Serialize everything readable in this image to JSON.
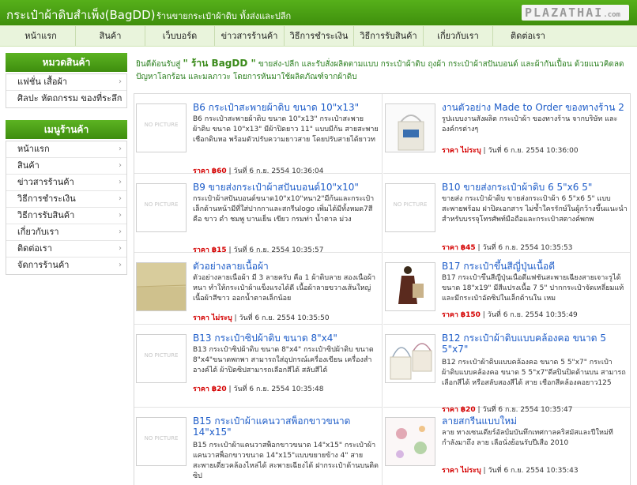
{
  "header": {
    "title": "กระเป๋าผ้าดิบสำเพ็ง(BagDD)",
    "slogan": "ร้านขายกระเป๋าผ้าดิบ ทั้งส่งและปลีก",
    "logo_main": "PLAZATHAI",
    "logo_suffix": ".com"
  },
  "topnav": [
    "หน้าแรก",
    "สินค้า",
    "เว็บบอร์ด",
    "ข่าวสารร้านค้า",
    "วิธีการชำระเงิน",
    "วิธีการรับสินค้า",
    "เกี่ยวกับเรา",
    "ติดต่อเรา"
  ],
  "categories": {
    "title": "หมวดสินค้า",
    "items": [
      "แฟชั่น เสื้อผ้า",
      "ศิลปะ หัตถกรรม ของที่ระลึก"
    ]
  },
  "shop_menu": {
    "title": "เมนูร้านค้า",
    "items": [
      "หน้าแรก",
      "สินค้า",
      "ข่าวสารร้านค้า",
      "วิธีการชำระเงิน",
      "วิธีการรับสินค้า",
      "เกี่ยวกับเรา",
      "ติดต่อเรา",
      "จัดการร้านค้า"
    ]
  },
  "welcome": {
    "prefix": "ยินดีต้อนรับสู่",
    "shop_name": "\" ร้าน BagDD \"",
    "text": "ขายส่ง-ปลีก และรับสั่งผลิตตามแบบ กระเป๋าผ้าดิบ ถุงผ้า กระเป๋าผ้าสปันบอนด์ และผ้ากันเปื้อน ด้วยแนวคิดลดปัญหาโลกร้อน และมลภาวะ โดยการหันมาใช้ผลิตภัณฑ์จากผ้าดิบ"
  },
  "labels": {
    "price": "ราคา",
    "date": "วันที่",
    "no_picture": "NO PICTURE"
  },
  "products": [
    {
      "title": "B6 กระเป๋าสะพายผ้าดิบ ขนาด 10\"x13\"",
      "desc": "B6 กระเป๋าสะพายผ้าดิบ ขนาด 10\"x13\" กระเป๋าสะพายผ้าดิบ ขนาด 10\"x13\" มีผ้าปิดยาว 11\" แบบมีก้น สายสะพายเชือกดิบหอ พร้อมตัวปรับความยาวสาย โดยปรับสายได้ยาวท",
      "price": "฿60",
      "date": "6 ก.ย. 2554 10:36:04",
      "image": "none"
    },
    {
      "title": "งานตัวอย่าง Made to Order ของทางร้าน 2",
      "desc": "รูปแบบงานสั่งผลิต กระเป๋าผ้า ของทางร้าน จากบริษัท และองค์กรต่างๆ",
      "price": "ไม่ระบุ",
      "date": "6 ก.ย. 2554 10:36:00",
      "image": "tote"
    },
    {
      "title": "B9 ขายส่งกระเป๋าผ้าสปันบอนด์10\"x10\"",
      "desc": "กระเป๋าผ้าสปันบอนด์ขนาด10\"x10\"หนา2\"มีก้นและกระเป๋าเล็กด้านหน้ามีที่ใส่ปากกาและสกรีนlogo เพิ่มได้มีทั้งหมด7สีคือ ขาว ดำ ชมพู บานเย็น เขียว กรมท่า น้ำตาล ม่วง",
      "price": "฿15",
      "date": "6 ก.ย. 2554 10:35:57",
      "image": "none"
    },
    {
      "title": "B10 ขายส่งกระเป๋าผ้าดิบ 6 5\"x6 5\"",
      "desc": "ขายส่ง กระเป๋าผ้าดิบ ขายส่งกระเป๋าผ้า 6 5\"x6 5\" แบบสะพายพร้อม ฝาปิดเอกสาร ไม่ซ้ำใครรักษ์ในผู้กว้างขึ้นแนะนำสำหรับบรรจุโทรศัพท์มือถือและกระเป๋าสตางค์พกพ",
      "price": "฿45",
      "date": "6 ก.ย. 2554 10:35:53",
      "image": "none"
    },
    {
      "title": "ตัวอย่างลายเนื้อผ้า",
      "desc": "ตัวอย่างลายเนื้อผ้า มี 3 ลายครับ คือ 1 ผ้าดิบลาย สองเนื้อผ้าหนา ทำให้กระเป๋าผ้าแข็งแรงได้ดี เนื้อผ้าลายขวางเส้นใหญ่ เนื้อผ้าสีขาว ออกน้ำตาลเล็กน้อย",
      "price": "ไม่ระบุ",
      "date": "6 ก.ย. 2554 10:35:50",
      "image": "fabric"
    },
    {
      "title": "B17 กระเป๋าขึ้นสีญี่ปุ่นเนื้อดี",
      "desc": "B17 กระเป๋าขึ้นสีญี่ปุ่นเนื้อดีแฟชั่นสะพายเฉียงสายเจาะรูได้ ขนาด 18\"x19\" มีสีแปรงเนื้อ 7 5\" ปากกระเป๋าจัดเหลี่ยมแท้และมีกระเป๋าอัดซิปในเล็กด้านใน เหม",
      "price": "฿150",
      "date": "6 ก.ย. 2554 10:35:49",
      "image": "model"
    },
    {
      "title": "B13 กระเป๋าซิปผ้าดิบ ขนาด 8\"x4\"",
      "desc": "B13 กระเป๋าซิปผ้าดิบ ขนาด 8\"x4\" กระเป๋าซิปผ้าดิบ ขนาด 8\"x4\"ขนาดพกพา สามารถใส่อุปกรณ์เครื่องเขียน เครื่องสำอางค์ได้ ผ้าปิดซิปสามารถเลือกสีได้ สลับสีได้",
      "price": "฿20",
      "date": "6 ก.ย. 2554 10:35:48",
      "image": "none"
    },
    {
      "title": "B12 กระเป๋าผ้าดิบแบบคล้องคอ ขนาด 5 5\"x7\"",
      "desc": "B12 กระเป๋าผ้าดิบแบบคล้องคอ ขนาด 5 5\"x7\" กระเป๋าผ้าดิบแบบคล้องคอ ขนาด 5 5\"x7\"ดีสปินปิดด้านบน สามารถเลือกสีได้ หรือสลับสองสีได้ สาย เชือกสีคล้องคอยาว125",
      "price": "฿20",
      "date": "6 ก.ย. 2554 10:35:47",
      "image": "pouch"
    },
    {
      "title": "B15 กระเป๋าผ้าแคนวาสพ็อกขาวขนาด 14\"x15\"",
      "desc": "B15 กระเป๋าผ้าแคนวาสพ็อกขาวขนาด 14\"x15\" กระเป๋าผ้าแคนวาสพ็อกขาวขนาด 14\"x15\"แบบขยายข้าง 4\" สายสะพายเดี่ยวคล้องไหล่ได้ สะพายเฉียงได้ ฝากระเป๋าด้านบนติดซิป",
      "price": "",
      "date": "",
      "image": "none"
    },
    {
      "title": "ลายสกรีนแบบใหม่",
      "desc": "ลาย ทางเซนเดียร์อัลบั้มบันทึกเทศกาลคริสมัสและปีใหม่ที่กำลังมาถึง ลาย เลือนั่งย้อนรับปีเสือ 2010",
      "price": "ไม่ระบุ",
      "date": "6 ก.ย. 2554 10:35:43",
      "image": "screen"
    }
  ]
}
